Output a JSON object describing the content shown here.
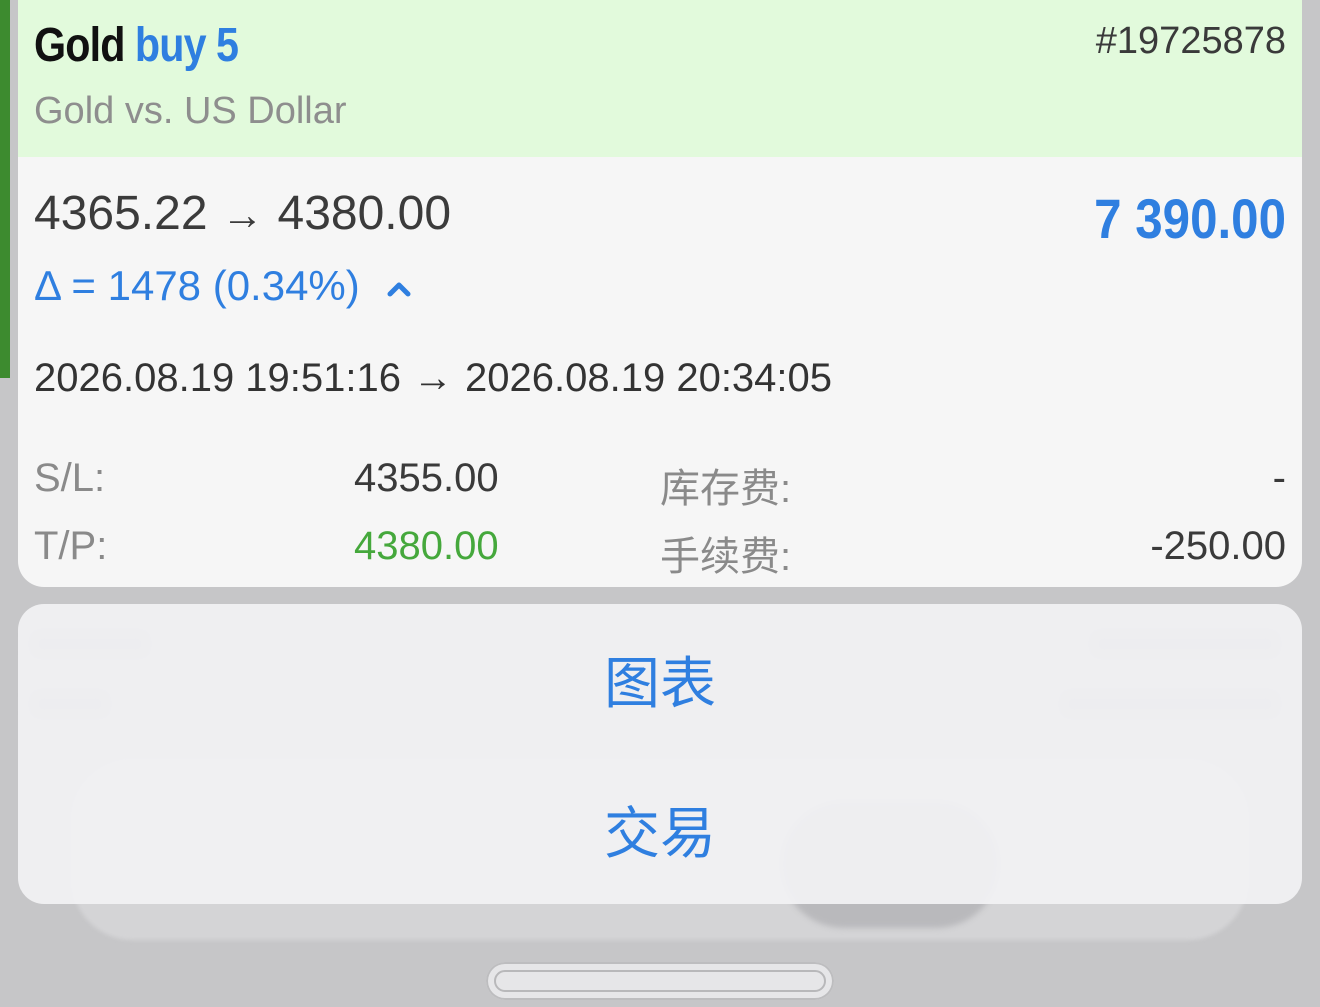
{
  "trade": {
    "symbol": "Gold",
    "type": "buy",
    "volume": "5",
    "ticket": "#19725878",
    "description": "Gold vs. US Dollar",
    "open_price": "4365.22",
    "close_price": "4380.00",
    "price_arrow": "→",
    "profit": "7 390.00",
    "delta": "Δ = 1478 (0.34%)",
    "open_time": "2026.08.19 19:51:16",
    "close_time": "2026.08.19 20:34:05",
    "time_arrow": "→",
    "sl_label": "S/L:",
    "sl_value": "4355.00",
    "tp_label": "T/P:",
    "tp_value": "4380.00",
    "swap_label": "库存费:",
    "swap_value": "-",
    "commission_label": "手续费:",
    "commission_value": "-250.00"
  },
  "actions": {
    "chart_label": "图表",
    "trade_label": "交易"
  },
  "colors": {
    "accent_blue": "#2f7fe0",
    "header_green": "#e2fadc",
    "tp_green": "#45a83c"
  },
  "icons": {
    "delta_toggle": "chevron-up-icon"
  }
}
